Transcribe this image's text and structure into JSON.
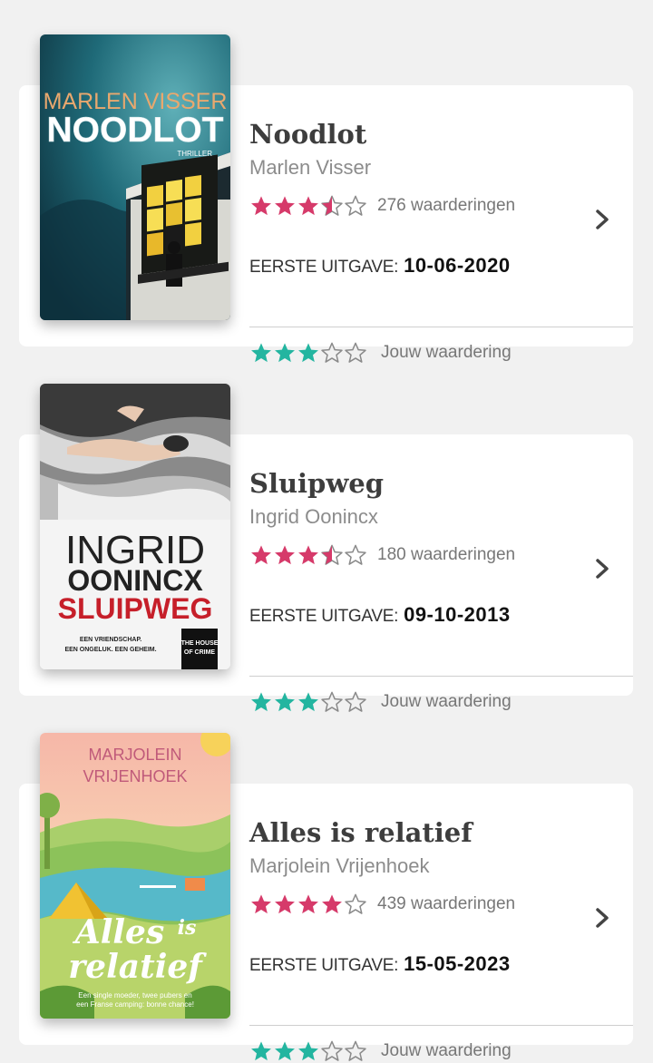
{
  "colors": {
    "background": "#f1f1f1",
    "card": "#ffffff",
    "average_star": "#d63a6a",
    "user_star": "#23b5a0",
    "empty_star": "#8a8a8a"
  },
  "icons": {
    "star": "star-icon",
    "half_star": "half-star-icon",
    "chevron": "chevron-right-icon"
  },
  "labels": {
    "published": "EERSTE UITGAVE:",
    "your_rating": "Jouw waardering"
  },
  "books": [
    {
      "title": "Noodlot",
      "author": "Marlen Visser",
      "average_rating": 3.5,
      "ratings_count": "276 waarderingen",
      "first_published": "10-06-2020",
      "your_rating": 3,
      "cover": {
        "author": "MARLEN VISSER",
        "title": "NOODLOT",
        "genre": "THRILLER"
      }
    },
    {
      "title": "Sluipweg",
      "author": "Ingrid Oonincx",
      "average_rating": 3.5,
      "ratings_count": "180 waarderingen",
      "first_published": "09-10-2013",
      "your_rating": 3,
      "cover": {
        "author_first": "INGRID",
        "author_last": "OONINCX",
        "title": "SLUIPWEG",
        "tagline_1": "EEN VRIENDSCHAP.",
        "tagline_2": "EEN ONGELUK. EEN GEHEIM.",
        "publisher_1": "THE HOUSE",
        "publisher_2": "OF CRIME"
      }
    },
    {
      "title": "Alles is relatief",
      "author": "Marjolein Vrijenhoek",
      "average_rating": 4,
      "ratings_count": "439 waarderingen",
      "first_published": "15-05-2023",
      "your_rating": 3,
      "cover": {
        "author_first": "MARJOLEIN",
        "author_last": "VRIJENHOEK",
        "title_1": "Alles",
        "title_2": "is",
        "title_3": "relatief",
        "tagline_1": "Een single moeder, twee pubers en",
        "tagline_2": "een Franse camping: bonne chance!"
      }
    }
  ]
}
